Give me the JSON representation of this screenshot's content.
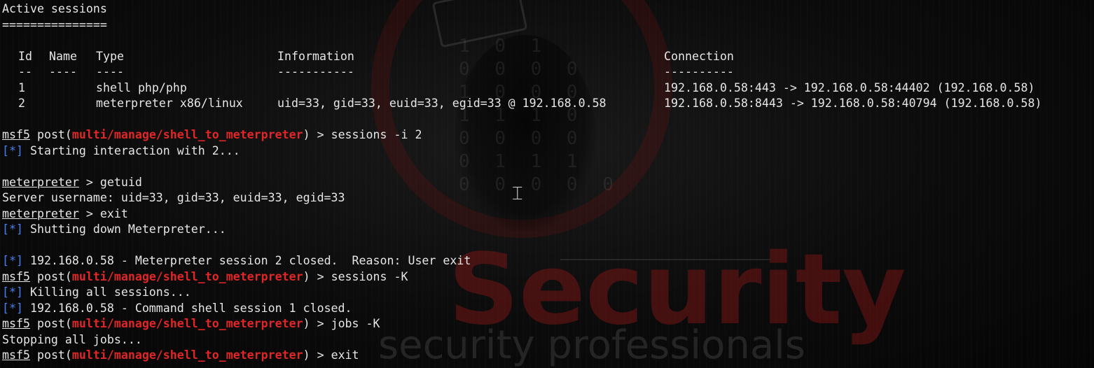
{
  "terminal": {
    "sessions_header": "Active sessions",
    "sessions_rule": "===============",
    "table": {
      "columns": [
        "Id",
        "Name",
        "Type",
        "Information",
        "Connection"
      ],
      "separators": [
        "--",
        "----",
        "----",
        "-----------",
        "----------"
      ],
      "rows": [
        {
          "id": "1",
          "name": "",
          "type": "shell php/php",
          "information": "",
          "connection": "192.168.0.58:443 -> 192.168.0.58:44402 (192.168.0.58)"
        },
        {
          "id": "2",
          "name": "",
          "type": "meterpreter x86/linux",
          "information": "uid=33, gid=33, euid=33, egid=33 @ 192.168.0.58",
          "connection": "192.168.0.58:8443 -> 192.168.0.58:40794 (192.168.0.58)"
        }
      ]
    },
    "prompt": {
      "name": "msf5",
      "post_open": " post(",
      "module": "multi/manage/shell_to_meterpreter",
      "post_close": ") > "
    },
    "meterpreter_prompt": "meterpreter",
    "meterpreter_suffix": " > ",
    "status_mark": "[*]",
    "cmd_sessions_i": "sessions -i 2",
    "msg_starting": " Starting interaction with 2...",
    "cmd_getuid": "getuid",
    "out_server_username": "Server username: uid=33, gid=33, euid=33, egid=33",
    "cmd_exit": "exit",
    "msg_shutting_down": " Shutting down Meterpreter...",
    "msg_session2_closed": " 192.168.0.58 - Meterpreter session 2 closed.  Reason: User exit",
    "cmd_sessions_K": "sessions -K",
    "msg_killing": " Killing all sessions...",
    "msg_session1_closed": " 192.168.0.58 - Command shell session 1 closed.",
    "cmd_jobs_K": "jobs -K",
    "out_stopping_jobs": "Stopping all jobs...",
    "cmd_final_exit": "exit"
  },
  "watermark": {
    "brand_text": "Security",
    "tagline_text": "security professionals",
    "binary_rows": "1 0 1\n0 0 0 0\n1 0 0 0\n1 1 1 0\n0 0 0 0\n0 1 1 1\n0 0 0 0 0"
  },
  "colors": {
    "background": "#0b0b0b",
    "text": "#e6e6e6",
    "module_red": "#e02626",
    "status_blue": "#4a7ef0"
  },
  "icons": {
    "mouse_cursor": "text-ibeam-cursor-icon"
  }
}
